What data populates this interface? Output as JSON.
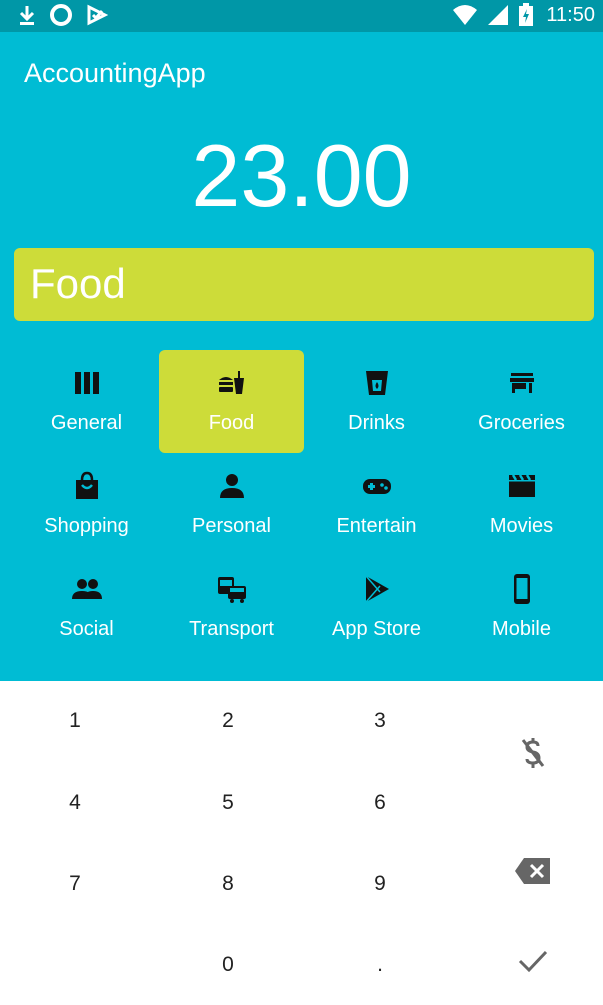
{
  "status_bar": {
    "time": "11:50"
  },
  "app": {
    "title": "AccountingApp"
  },
  "amount": "23.00",
  "selected_category": "Food",
  "categories": [
    {
      "label": "General",
      "icon": "general-icon"
    },
    {
      "label": "Food",
      "icon": "food-icon"
    },
    {
      "label": "Drinks",
      "icon": "drinks-icon"
    },
    {
      "label": "Groceries",
      "icon": "groceries-icon"
    },
    {
      "label": "Shopping",
      "icon": "shopping-icon"
    },
    {
      "label": "Personal",
      "icon": "personal-icon"
    },
    {
      "label": "Entertain",
      "icon": "entertain-icon"
    },
    {
      "label": "Movies",
      "icon": "movies-icon"
    },
    {
      "label": "Social",
      "icon": "social-icon"
    },
    {
      "label": "Transport",
      "icon": "transport-icon"
    },
    {
      "label": "App Store",
      "icon": "app-store-icon"
    },
    {
      "label": "Mobile",
      "icon": "mobile-icon"
    }
  ],
  "keypad": {
    "keys": [
      "1",
      "2",
      "3",
      "4",
      "5",
      "6",
      "7",
      "8",
      "9",
      "0",
      "."
    ],
    "side_buttons": [
      "currency-off-icon",
      "backspace-icon",
      "check-icon"
    ]
  },
  "colors": {
    "primary": "#00bcd4",
    "primary_dark": "#0097a7",
    "accent": "#cddc39"
  }
}
